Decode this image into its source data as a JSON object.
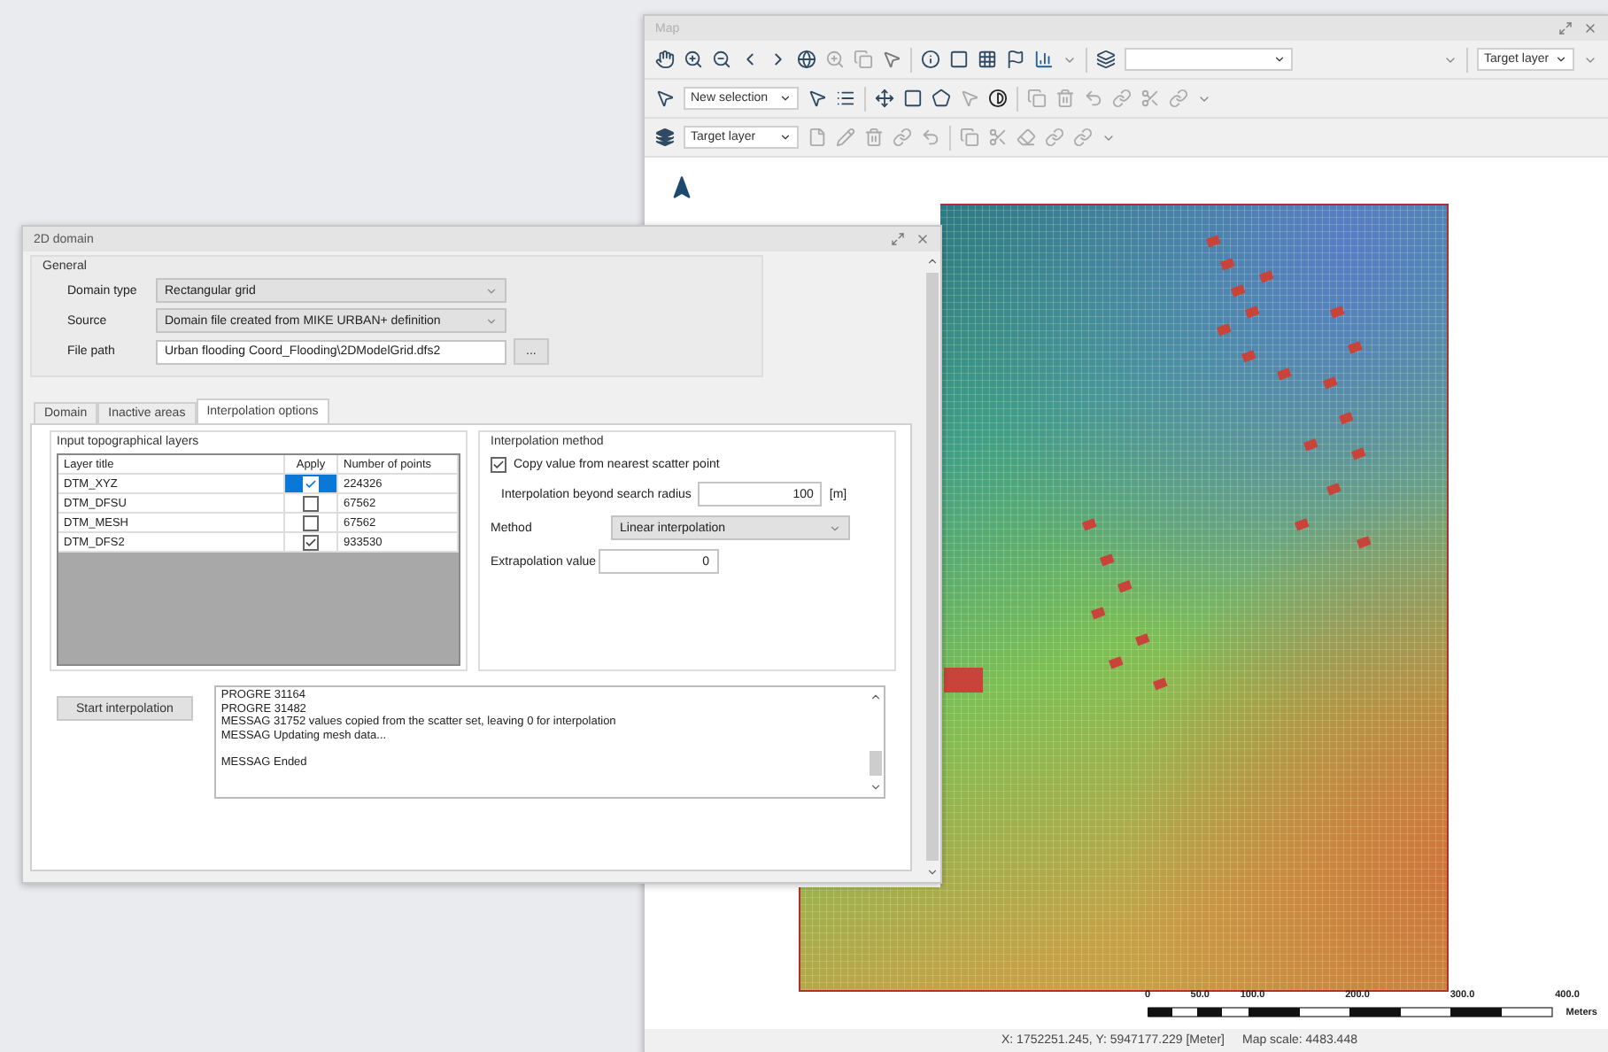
{
  "map_window": {
    "title": "Map",
    "toolbars": {
      "target_layer_right": "Target layer",
      "selection_mode": "New selection",
      "edit_target": "Target layer"
    },
    "scale_bar": {
      "labels": [
        "0",
        "50.0",
        "100.0",
        "200.0",
        "300.0",
        "400.0"
      ],
      "unit": "Meters"
    },
    "status_bar": {
      "coordinates": "X: 1752251.245, Y: 5947177.229 [Meter]",
      "map_scale": "Map scale: 4483.448"
    }
  },
  "dialog": {
    "title": "2D domain",
    "general": {
      "title": "General",
      "fields": [
        {
          "label": "Domain type",
          "kind": "dropdown",
          "value": "Rectangular grid"
        },
        {
          "label": "Source",
          "kind": "dropdown",
          "value": "Domain file created from MIKE URBAN+ definition"
        },
        {
          "label": "File path",
          "kind": "text",
          "value": "Urban flooding Coord_Flooding\\2DModelGrid.dfs2",
          "browse": "..."
        }
      ]
    },
    "tabs": [
      {
        "label": "Domain",
        "selected": false
      },
      {
        "label": "Inactive areas",
        "selected": false
      },
      {
        "label": "Interpolation options",
        "selected": true
      }
    ],
    "layers": {
      "title": "Input topographical layers",
      "columns": [
        "Layer title",
        "Apply",
        "Number of points"
      ],
      "rows": [
        {
          "title": "DTM_XYZ",
          "apply": true,
          "points": "224326",
          "selected": true
        },
        {
          "title": "DTM_DFSU",
          "apply": false,
          "points": "67562",
          "selected": false
        },
        {
          "title": "DTM_MESH",
          "apply": false,
          "points": "67562",
          "selected": false
        },
        {
          "title": "DTM_DFS2",
          "apply": true,
          "points": "933530",
          "selected": false
        }
      ]
    },
    "interpolation": {
      "title": "Interpolation method",
      "copy_nearest": {
        "label": "Copy value from nearest scatter point",
        "checked": true
      },
      "radius": {
        "label": "Interpolation beyond search radius",
        "value": "100",
        "unit": "[m]"
      },
      "method": {
        "label": "Method",
        "value": "Linear interpolation"
      },
      "extrapolation": {
        "label": "Extrapolation value",
        "value": "0"
      }
    },
    "start_button": "Start interpolation",
    "log": [
      [
        "PROGRE 31164",
        "PROGRE 31482",
        "MESSAG 31752 values copied from the scatter set, leaving 0 for interpolation",
        "MESSAG Updating mesh data..."
      ],
      [
        "MESSAG Ended"
      ]
    ]
  }
}
